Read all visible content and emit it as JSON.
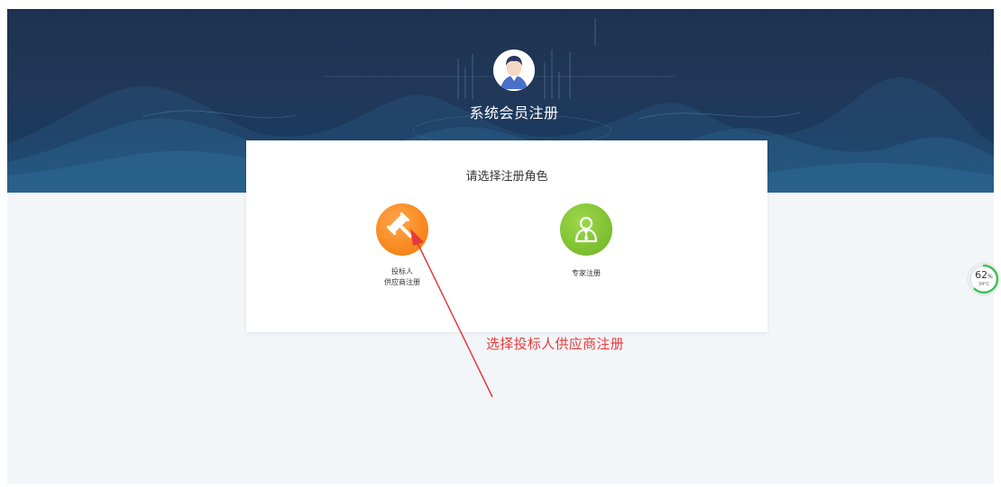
{
  "header": {
    "title": "系统会员注册",
    "avatar_icon": "user-avatar-icon"
  },
  "card": {
    "title": "请选择注册角色",
    "roles": [
      {
        "id": "bidder",
        "icon": "gavel-icon",
        "color": "#f7891f",
        "label_line1": "投标人",
        "label_line2": "供应商注册"
      },
      {
        "id": "expert",
        "icon": "expert-person-icon",
        "color": "#7fc233",
        "label_line1": "专家注册"
      }
    ]
  },
  "annotation": {
    "text": "选择投标人供应商注册",
    "color": "#e53b3b"
  },
  "perf_widget": {
    "value": "62",
    "unit": "%",
    "temperature": "34°C",
    "progress": 0.62
  },
  "colors": {
    "hero_bg": "#213858",
    "page_bg": "#f3f6f9"
  }
}
